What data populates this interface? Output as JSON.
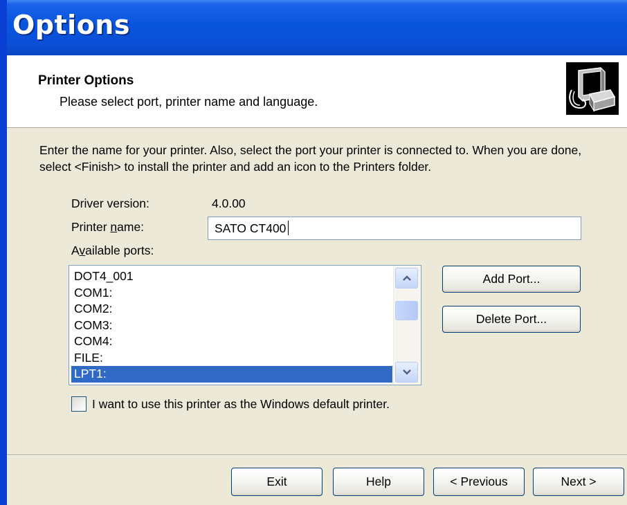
{
  "window": {
    "title": "Options"
  },
  "header": {
    "title": "Printer Options",
    "subtitle": "Please select port, printer name and language.",
    "icon": "printer-setup-icon"
  },
  "intro": "Enter the name for your printer. Also, select the port your printer is connected to. When you are done, select <Finish> to install the printer and add an icon to the Printers folder.",
  "driver": {
    "label": "Driver version:",
    "value": "4.0.00"
  },
  "printer_name": {
    "label_pre": "Printer ",
    "label_key": "n",
    "label_post": "ame:",
    "value": "SATO CT400"
  },
  "ports": {
    "label_pre": "A",
    "label_key": "v",
    "label_post": "ailable ports:",
    "items": [
      "DOT4_001",
      "COM1:",
      "COM2:",
      "COM3:",
      "COM4:",
      "FILE:",
      "LPT1:"
    ],
    "selected": "LPT1:"
  },
  "port_buttons": {
    "add": "Add Port...",
    "delete": "Delete Port..."
  },
  "default_checkbox": {
    "label": "I want to use this printer as the Windows default printer.",
    "checked": false
  },
  "footer": {
    "exit": "Exit",
    "help": "Help",
    "previous": "< Previous",
    "next": "Next >"
  },
  "colors": {
    "titlebar": "#0a4fd6",
    "selection": "#316ac5",
    "face": "#ece9d8",
    "button_border": "#003c74"
  }
}
